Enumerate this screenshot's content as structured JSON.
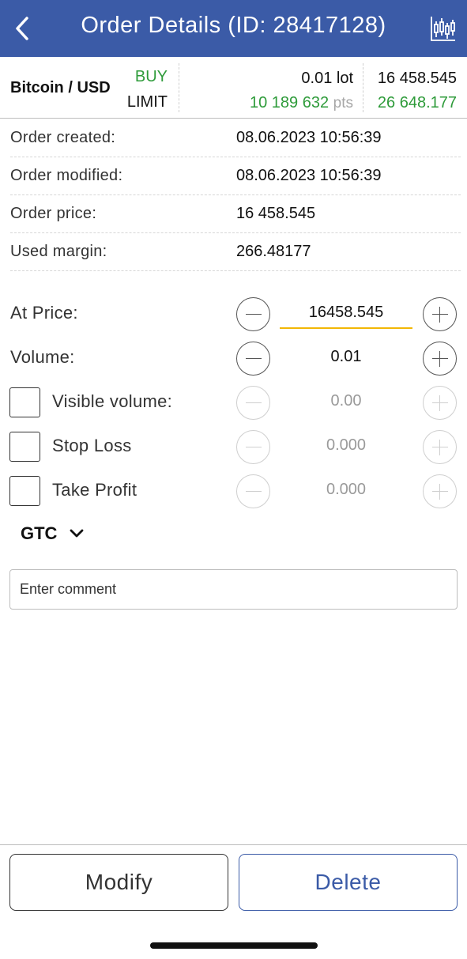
{
  "header": {
    "title": "Order Details (ID: 28417128)",
    "back_icon": "chevron-left-icon",
    "chart_icon": "candlestick-chart-icon",
    "bg_color": "#3b5ba7"
  },
  "summary": {
    "symbol": "Bitcoin / USD",
    "side": "BUY",
    "order_type": "LIMIT",
    "lot": "0.01 lot",
    "points_value": "10 189 632",
    "points_unit": "pts",
    "price": "16 458.545",
    "current_price": "26 648.177",
    "accent_green": "#2e9b3a"
  },
  "info": [
    {
      "label": "Order created:",
      "value": "08.06.2023 10:56:39"
    },
    {
      "label": "Order modified:",
      "value": "08.06.2023 10:56:39"
    },
    {
      "label": "Order price:",
      "value": "16 458.545"
    },
    {
      "label": "Used margin:",
      "value": "266.48177"
    }
  ],
  "form": {
    "at_price": {
      "label": "At Price:",
      "value": "16458.545"
    },
    "volume": {
      "label": "Volume:",
      "value": "0.01"
    },
    "visible_volume": {
      "label": "Visible volume:",
      "value": "0.00",
      "checked": false
    },
    "stop_loss": {
      "label": "Stop Loss",
      "value": "0.000",
      "checked": false
    },
    "take_profit": {
      "label": "Take Profit",
      "value": "0.000",
      "checked": false
    }
  },
  "expiry": {
    "label": "GTC",
    "icon": "chevron-down-icon"
  },
  "comment": {
    "placeholder": "Enter comment",
    "value": ""
  },
  "buttons": {
    "modify_label": "Modify",
    "delete_label": "Delete"
  }
}
